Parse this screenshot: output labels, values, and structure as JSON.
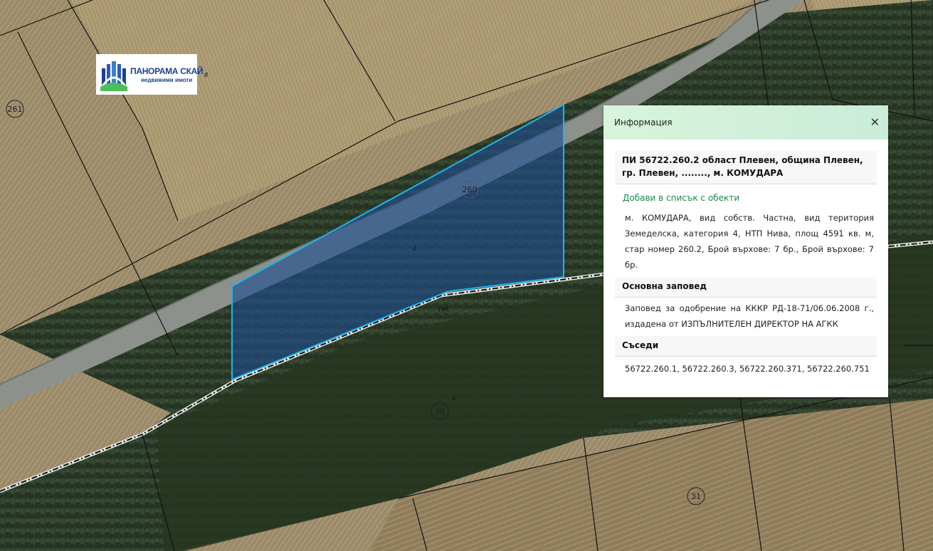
{
  "colors": {
    "highlight_fill": "#1f4d8f",
    "highlight_stroke": "#1fb5ef",
    "cadastre_line": "#111111",
    "panel_header": "#d9f4dc",
    "link": "#1a8a4a"
  },
  "map": {
    "parcel_labels": [
      "261",
      "260",
      "30",
      "31"
    ],
    "small_labels": [
      "8",
      "2",
      "198",
      "4"
    ]
  },
  "logo": {
    "brand": "ПАНОРАМА СКАЙ",
    "subtitle": "недвижими имоти"
  },
  "info_panel": {
    "title": "Информация",
    "close_icon": "close-icon",
    "parcel_title": "ПИ 56722.260.2 област Плевен, община Плевен, гр. Плевен, ........, м. КОМУДАРА",
    "add_link": "Добави в списък с обекти",
    "description": "м. КОМУДАРА, вид собств. Частна, вид територия Земеделска, категория 4, НТП Нива, площ 4591 кв. м, стар номер 260.2, Брой върхове: 7 бр., Брой върхове: 7 бр.",
    "order_heading": "Основна заповед",
    "order_text": "Заповед за одобрение на КККР РД-18-71/06.06.2008 г., издадена от ИЗПЪЛНИТЕЛЕН ДИРЕКТОР НА АГКК",
    "neighbors_heading": "Съседи",
    "neighbors_text": "56722.260.1, 56722.260.3, 56722.260.371, 56722.260.751"
  }
}
